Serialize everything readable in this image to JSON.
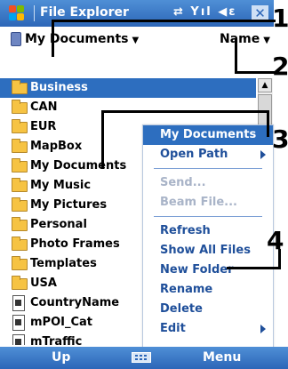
{
  "titlebar": {
    "title": "File Explorer",
    "start_icon": "windows-flag-icon",
    "status_icons": "⇄ Yıl ◀ε",
    "close_label": "✕"
  },
  "toolbar": {
    "folder": "My Documents",
    "sort": "Name",
    "caret": "▼"
  },
  "files": [
    {
      "name": "Business",
      "type": "folder",
      "selected": true
    },
    {
      "name": "CAN",
      "type": "folder"
    },
    {
      "name": "EUR",
      "type": "folder"
    },
    {
      "name": "MapBox",
      "type": "folder"
    },
    {
      "name": "My Documents",
      "type": "folder"
    },
    {
      "name": "My Music",
      "type": "folder"
    },
    {
      "name": "My Pictures",
      "type": "folder"
    },
    {
      "name": "Personal",
      "type": "folder"
    },
    {
      "name": "Photo Frames",
      "type": "folder"
    },
    {
      "name": "Templates",
      "type": "folder"
    },
    {
      "name": "USA",
      "type": "folder"
    },
    {
      "name": "CountryName",
      "type": "file"
    },
    {
      "name": "mPOI_Cat",
      "type": "file"
    },
    {
      "name": "mTraffic",
      "type": "file"
    }
  ],
  "menu": {
    "items": [
      {
        "label": "My Documents",
        "active": true
      },
      {
        "label": "Open Path",
        "submenu": true
      },
      {
        "label": "Send...",
        "disabled": true
      },
      {
        "label": "Beam File...",
        "disabled": true
      },
      {
        "label": "Refresh"
      },
      {
        "label": "Show All Files"
      },
      {
        "label": "New Folder"
      },
      {
        "label": "Rename"
      },
      {
        "label": "Delete"
      },
      {
        "label": "Edit",
        "submenu": true
      }
    ]
  },
  "callouts": [
    "1",
    "2",
    "3",
    "4"
  ],
  "softkeys": {
    "left": "Up",
    "right": "Menu"
  },
  "colors": {
    "accent": "#2d6ebf",
    "menu_text": "#1f4f9a",
    "folder": "#f6c343"
  }
}
